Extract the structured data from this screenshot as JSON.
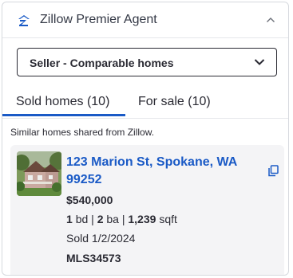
{
  "header": {
    "title": "Zillow Premier Agent",
    "logo_icon": "zillow-logo-icon",
    "collapse_icon": "chevron-up-icon"
  },
  "select": {
    "value": "Seller - Comparable homes",
    "icon": "chevron-down-icon"
  },
  "tabs": [
    {
      "label": "Sold homes (10)",
      "active": true
    },
    {
      "label": "For sale (10)",
      "active": false
    }
  ],
  "shared_note": "Similar homes shared from Zillow.",
  "listing": {
    "address": "123 Marion St, Spokane, WA 99252",
    "price": "$540,000",
    "beds": "1",
    "beds_unit": "bd",
    "baths": "2",
    "baths_unit": "ba",
    "sqft": "1,239",
    "sqft_unit": "sqft",
    "separator": "|",
    "sold": "Sold 1/2/2024",
    "mls": "MLS34573",
    "copy_icon": "copy-icon"
  },
  "colors": {
    "accent": "#1a5ac6",
    "text": "#2a2a33",
    "card_bg": "#f4f4f6"
  }
}
